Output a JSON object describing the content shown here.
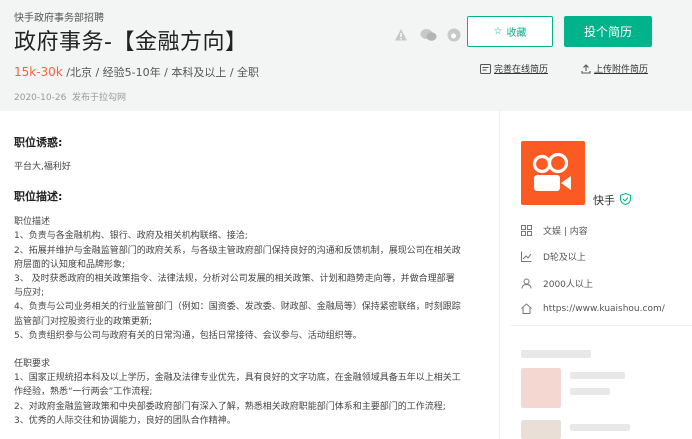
{
  "header": {
    "company_tag": "快手政府事务部招聘",
    "title": "政府事务-【金融方向】",
    "salary": "15k-30k",
    "meta": " /北京 / 经验5-10年 / 本科及以上 / 全职",
    "date": "2020-10-26",
    "date_suffix": "发布于拉勾网",
    "collect_label": "收藏",
    "apply_label": "投个简历",
    "perfect_resume_label": "完善在线简历",
    "upload_resume_label": "上传附件简历"
  },
  "job": {
    "temptation_title": "职位诱惑:",
    "temptation_text": "平台大,福利好",
    "desc_title": "职位描述:",
    "desc_lines": [
      "职位描述",
      "1、负责与各金融机构、银行、政府及相关机构联络、接洽;",
      "2、拓展并维护与金融监管部门的政府关系，与各级主管政府部门保持良好的沟通和反馈机制，展现公司在相关政",
      "府层面的认知度和品牌形象;",
      "3、 及时获悉政府的相关政策指令、法律法规，分析对公司发展的相关政策、计划和趋势走向等，并做合理部署",
      "与应对;",
      "4、负责与公司业务相关的行业监管部门（例如：国资委、发改委、财政部、金融局等）保持紧密联络，时刻跟踪",
      "监管部门对控股资行业的政策更新;",
      "5、负责组织参与公司与政府有关的日常沟通，包括日常接待、会议参与、活动组织等。"
    ],
    "req_lines": [
      "任职要求",
      "1、国家正规统招本科及以上学历，金融及法律专业优先，具有良好的文字功底，在金融领域具备五年以上相关工",
      "作经验，熟悉“一行两会”工作流程;",
      "2、对政府金融监管政策和中央部委政府部门有深入了解，熟悉相关政府职能部门体系和主要部门的工作流程;",
      "3、优秀的人际交往和协调能力，良好的团队合作精神。"
    ]
  },
  "company": {
    "name": "快手",
    "field": "文娱 | 内容",
    "stage": "D轮及以上",
    "size": "2000人以上",
    "url": "https://www.kuaishou.com/"
  },
  "colors": {
    "accent": "#00b38a",
    "salary": "#fd5f39",
    "logo_bg": "#fb5a23"
  }
}
